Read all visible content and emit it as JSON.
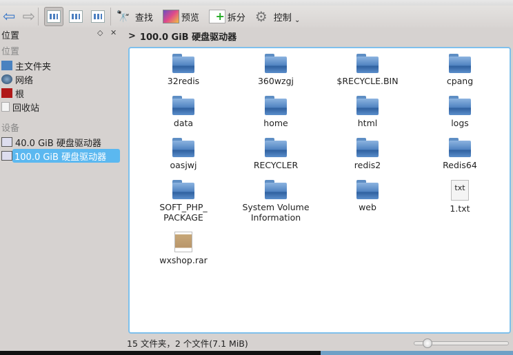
{
  "toolbar": {
    "find": "查找",
    "preview": "预览",
    "split": "拆分",
    "control": "控制"
  },
  "sidebar": {
    "title": "位置",
    "places_header": "位置",
    "places": [
      "主文件夹",
      "网络",
      "根",
      "回收站"
    ],
    "devices_header": "设备",
    "devices": [
      "40.0 GiB 硬盘驱动器",
      "100.0 GiB 硬盘驱动器"
    ]
  },
  "breadcrumb": {
    "path": "100.0 GiB 硬盘驱动器"
  },
  "items": [
    {
      "name": "32redis",
      "type": "folder"
    },
    {
      "name": "360wzgj",
      "type": "folder"
    },
    {
      "name": "$RECYCLE.BIN",
      "type": "folder"
    },
    {
      "name": "cpang",
      "type": "folder"
    },
    {
      "name": "data",
      "type": "folder"
    },
    {
      "name": "home",
      "type": "folder"
    },
    {
      "name": "html",
      "type": "folder"
    },
    {
      "name": "logs",
      "type": "folder"
    },
    {
      "name": "oasjwj",
      "type": "folder"
    },
    {
      "name": "RECYCLER",
      "type": "folder"
    },
    {
      "name": "redis2",
      "type": "folder"
    },
    {
      "name": "Redis64",
      "type": "folder"
    },
    {
      "name": "SOFT_PHP_\nPACKAGE",
      "type": "folder"
    },
    {
      "name": "System Volume\nInformation",
      "type": "folder"
    },
    {
      "name": "web",
      "type": "folder"
    },
    {
      "name": "1.txt",
      "type": "txt",
      "icon_text": "txt"
    },
    {
      "name": "wxshop.rar",
      "type": "rar"
    }
  ],
  "status": {
    "text": "15 文件夹，2 个文件(7.1 MiB)",
    "zoom_percent": 10
  }
}
